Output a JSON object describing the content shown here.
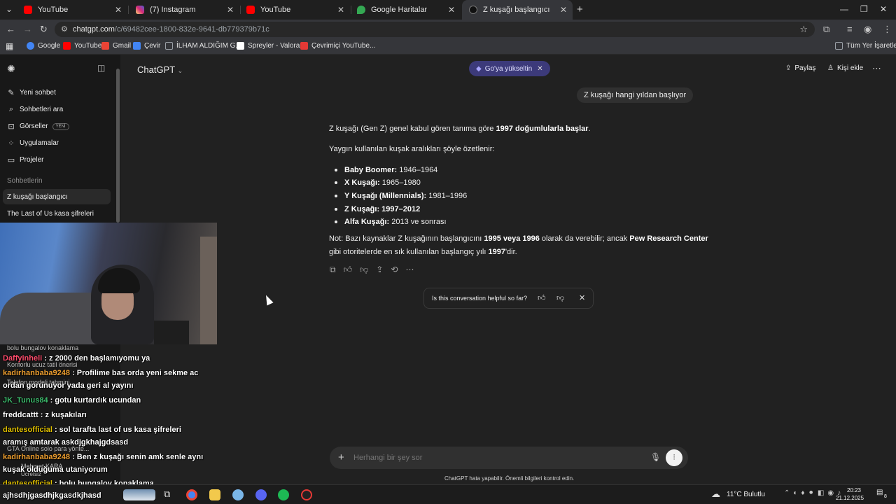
{
  "browser": {
    "tabs": [
      {
        "label": "YouTube",
        "icon": "youtube-icon",
        "color": "#ff0000"
      },
      {
        "label": "(7) Instagram",
        "icon": "instagram-icon",
        "color": "#d6249f"
      },
      {
        "label": "YouTube",
        "icon": "youtube-icon",
        "color": "#ff0000"
      },
      {
        "label": "Google Haritalar",
        "icon": "maps-icon",
        "color": "#34a853"
      },
      {
        "label": "Z kuşağı başlangıcı",
        "icon": "chatgpt-icon",
        "color": "#000000",
        "active": true
      }
    ],
    "url_host": "chatgpt.com",
    "url_path": "/c/69482cee-1800-832e-9641-db779379b71c",
    "bookmarks": [
      {
        "label": "Google",
        "icon": "google-icon",
        "color": "#4285f4"
      },
      {
        "label": "YouTube",
        "icon": "youtube-icon",
        "color": "#ff0000"
      },
      {
        "label": "Gmail",
        "icon": "gmail-icon",
        "color": "#ea4335"
      },
      {
        "label": "Çevir",
        "icon": "translate-icon",
        "color": "#4285f4"
      },
      {
        "label": "İLHAM ALDIĞIM G...",
        "icon": "folder-icon",
        "color": "#9aa0a6"
      },
      {
        "label": "Spreyler - Valorant",
        "icon": "valorant-icon",
        "color": "#ffffff"
      },
      {
        "label": "Çevrimiçi YouTube...",
        "icon": "youtube-converter-icon",
        "color": "#e53935"
      }
    ],
    "all_bookmarks": "Tüm Yer İşaretleri"
  },
  "sidebar": {
    "items": [
      {
        "label": "Yeni sohbet",
        "icon": "new-chat-icon"
      },
      {
        "label": "Sohbetleri ara",
        "icon": "search-icon"
      },
      {
        "label": "Görseller",
        "icon": "images-icon",
        "badge": "YENİ"
      },
      {
        "label": "Uygulamalar",
        "icon": "apps-icon"
      },
      {
        "label": "Projeler",
        "icon": "folder-icon"
      }
    ],
    "section_title": "Sohbetlerin",
    "chats": [
      "Z kuşağı başlangıcı",
      "The Last of Us kasa şifreleri"
    ]
  },
  "header": {
    "model": "ChatGPT",
    "upgrade": "Go'ya yükseltin",
    "share": "Paylaş",
    "add_person": "Kişi ekle"
  },
  "conversation": {
    "user_message": "Z kuşağı hangi yıldan başlıyor",
    "p1_pre": "Z kuşağı (Gen Z) genel kabul gören tanıma göre ",
    "p1_bold": "1997 doğumlularla başlar",
    "p1_post": ".",
    "p2": "Yaygın kullanılan kuşak aralıkları şöyle özetlenir:",
    "list": [
      {
        "name": "Baby Boomer:",
        "range": " 1946–1964",
        "range_bold": false
      },
      {
        "name": "X Kuşağı:",
        "range": " 1965–1980",
        "range_bold": false
      },
      {
        "name": "Y Kuşağı (Millennials):",
        "range": " 1981–1996",
        "range_bold": false
      },
      {
        "name": "Z Kuşağı:",
        "range": " 1997–2012",
        "range_bold": true
      },
      {
        "name": "Alfa Kuşağı:",
        "range": " 2013 ve sonrası",
        "range_bold": false
      }
    ],
    "note_l1_a": "Not: Bazı kaynaklar Z kuşağının başlangıcını ",
    "note_l1_b": "1995 veya 1996",
    "note_l1_c": " olarak da verebilir; ancak ",
    "note_l1_d": "Pew Research Center",
    "note_l2_a": "gibi otoritelerde en sık kullanılan başlangıç yılı ",
    "note_l2_b": "1997",
    "note_l2_c": "'dir.",
    "feedback_question": "Is this conversation helpful so far?"
  },
  "composer": {
    "placeholder": "Herhangi bir şey sor",
    "disclaimer": "ChatGPT hata yapabilir. Önemli bilgileri kontrol edin."
  },
  "overlay": {
    "chat": [
      {
        "user": "Daffyinheli",
        "color": "#ff4d6d",
        "text": " : z 2000 den başlamıyomu ya"
      },
      {
        "user": "kadirhanbaba9248",
        "color": "#f0a030",
        "text": " : Profilime bas orda yeni sekme ac"
      },
      {
        "user": "",
        "color": "#ffffff",
        "text": "ordan gorunuyor yada geri al yayını"
      },
      {
        "user": "JK_Tunus84",
        "color": "#3fbf6f",
        "text": " : gotu kurtardık ucundan"
      },
      {
        "user": "freddcattt",
        "color": "#ffffff",
        "text": " : z kuşakıları"
      },
      {
        "user": "dantesofficial",
        "color": "#e0c000",
        "text": " : sol tarafta last of us kasa şifreleri"
      },
      {
        "user": "",
        "color": "#ffffff",
        "text": "aramış amtarak askdjgkhajgdsasd"
      },
      {
        "user": "kadirhanbaba9248",
        "color": "#f0a030",
        "text": " : Ben z kuşağı senin amk senle aynı"
      },
      {
        "user": "",
        "color": "#ffffff",
        "text": "kuşak olduğuma utaniyorum"
      },
      {
        "user": "dantesofficial",
        "color": "#e0c000",
        "text": " : bolu bungalov konaklama"
      },
      {
        "user": "",
        "color": "#ffffff",
        "text": "ajhsdhjgasdhjkgasdkjhasd"
      }
    ],
    "ghost_sidebar": [
      "bolu bungalov konaklama",
      "Konforlu ucuz tatil önerisi",
      "Telefon modeli tahmini",
      "GTA Online solo para yönte...",
      "Mehmet KARA",
      "Ücretsiz"
    ]
  },
  "taskbar": {
    "weather": "11°C  Bulutlu",
    "time": "20:23",
    "date": "21.12.2025",
    "notifications": "8"
  }
}
